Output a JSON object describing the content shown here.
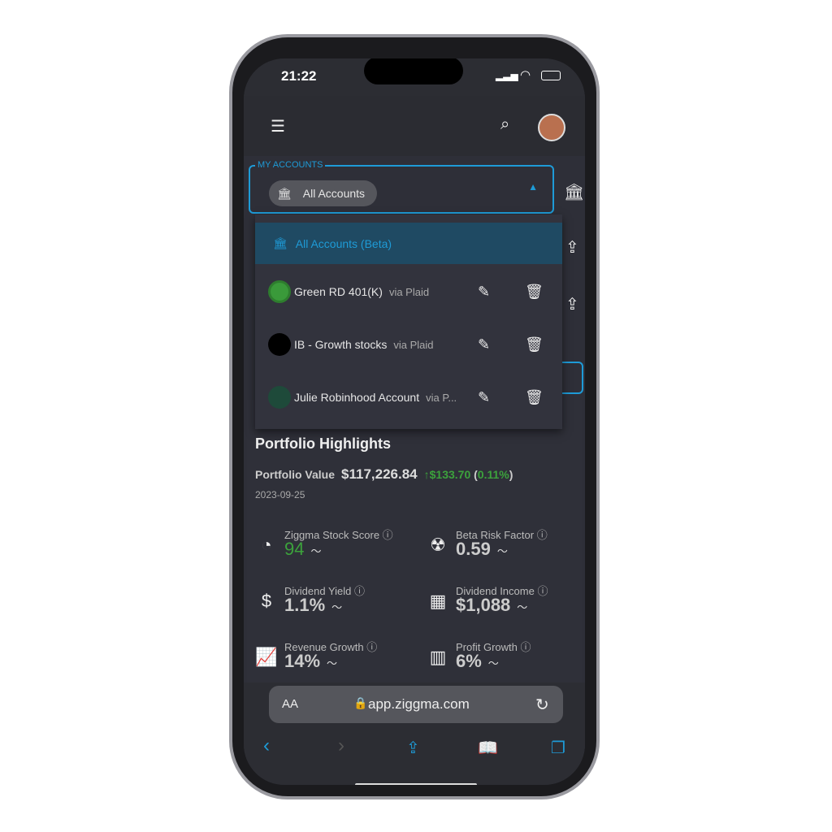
{
  "status": {
    "time": "21:22"
  },
  "header": {
    "menu_icon": "hamburger-icon",
    "search_icon": "search-icon"
  },
  "accounts": {
    "label": "MY ACCOUNTS",
    "selected": "All Accounts",
    "options": [
      {
        "name": "All Accounts (Beta)"
      },
      {
        "name": "Green RD 401(K)",
        "via": "via Plaid",
        "color": "#3a9a3a"
      },
      {
        "name": "IB - Growth stocks",
        "via": "via Plaid",
        "color": "#000000"
      },
      {
        "name": "Julie Robinhood Account",
        "via": "via P...",
        "color": "#1e4a3a"
      }
    ]
  },
  "highlights": {
    "title": "Portfolio Highlights",
    "value_label": "Portfolio Value",
    "value": "$117,226.84",
    "change": "$133.70",
    "change_pct": "0.11%",
    "date": "2023-09-25",
    "metrics": [
      {
        "label": "Ziggma Stock Score",
        "value": "94",
        "icon": "gauge-icon"
      },
      {
        "label": "Beta Risk Factor",
        "value": "0.59",
        "icon": "radiation-icon"
      },
      {
        "label": "Dividend Yield",
        "value": "1.1%",
        "icon": "hand-dollar-icon"
      },
      {
        "label": "Dividend Income",
        "value": "$1,088",
        "icon": "calculator-icon"
      },
      {
        "label": "Revenue Growth",
        "value": "14%",
        "icon": "line-chart-icon"
      },
      {
        "label": "Profit Growth",
        "value": "6%",
        "icon": "bar-chart-icon"
      }
    ]
  },
  "browser": {
    "aa": "AA",
    "url": "app.ziggma.com"
  },
  "colors": {
    "accent": "#1e9bd7",
    "positive": "#3ca23c"
  }
}
